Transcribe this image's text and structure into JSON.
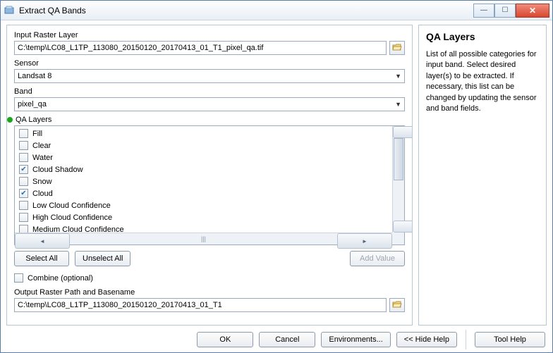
{
  "window": {
    "title": "Extract QA Bands"
  },
  "input_layer": {
    "label": "Input Raster Layer",
    "value": "C:\\temp\\LC08_L1TP_113080_20150120_20170413_01_T1_pixel_qa.tif"
  },
  "sensor": {
    "label": "Sensor",
    "value": "Landsat 8"
  },
  "band": {
    "label": "Band",
    "value": "pixel_qa"
  },
  "qa_layers": {
    "label": "QA Layers",
    "items": [
      {
        "label": "Fill",
        "checked": false
      },
      {
        "label": "Clear",
        "checked": false
      },
      {
        "label": "Water",
        "checked": false
      },
      {
        "label": "Cloud Shadow",
        "checked": true
      },
      {
        "label": "Snow",
        "checked": false
      },
      {
        "label": "Cloud",
        "checked": true
      },
      {
        "label": "Low Cloud Confidence",
        "checked": false
      },
      {
        "label": "High Cloud Confidence",
        "checked": false
      },
      {
        "label": "Medium Cloud Confidence",
        "checked": false
      }
    ]
  },
  "buttons": {
    "select_all": "Select All",
    "unselect_all": "Unselect All",
    "add_value": "Add Value"
  },
  "combine": {
    "label": "Combine (optional)",
    "checked": false
  },
  "output": {
    "label": "Output Raster Path and Basename",
    "value": "C:\\temp\\LC08_L1TP_113080_20150120_20170413_01_T1"
  },
  "footer": {
    "ok": "OK",
    "cancel": "Cancel",
    "environments": "Environments...",
    "hide_help": "<< Hide Help",
    "tool_help": "Tool Help"
  },
  "help": {
    "title": "QA Layers",
    "body": "List of all possible categories for input band. Select desired layer(s) to be extracted. If necessary, this list can be changed by updating the sensor and band fields."
  }
}
